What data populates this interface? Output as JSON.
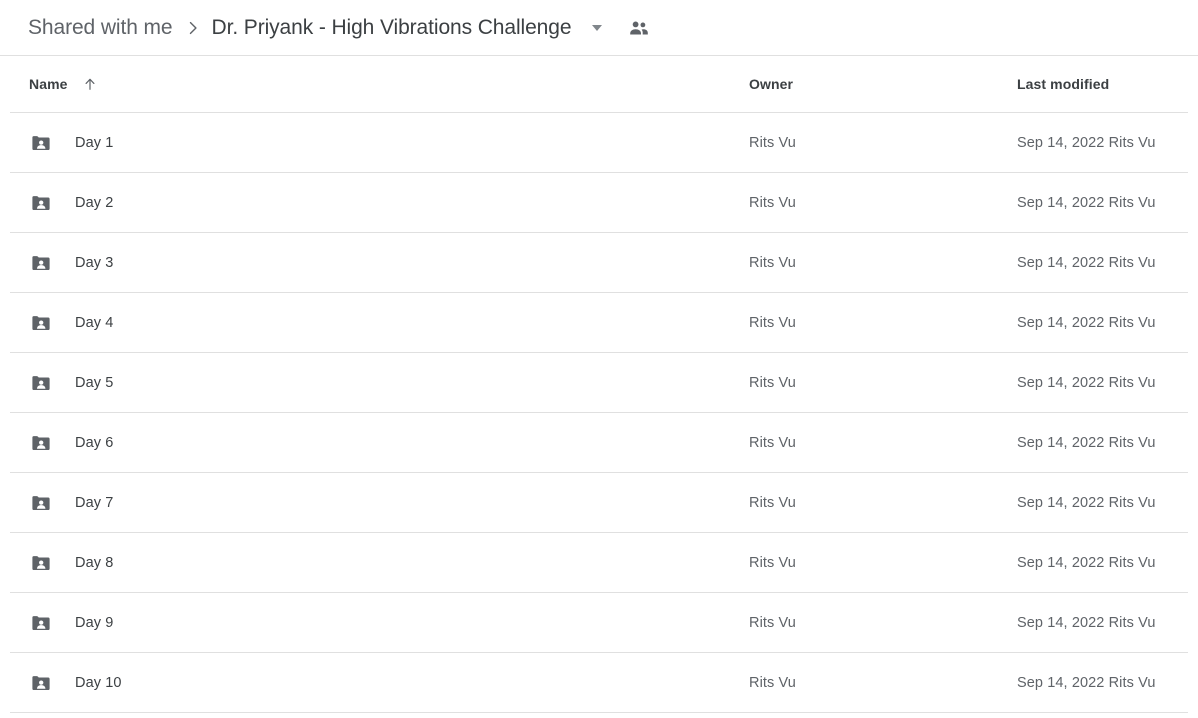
{
  "breadcrumb": {
    "parent_label": "Shared with me",
    "separator_icon": "chevron-right-icon",
    "current_label": "Dr. Priyank - High Vibrations Challenge",
    "caret_icon": "chevron-down-icon",
    "people_icon": "people-icon"
  },
  "columns": {
    "name_label": "Name",
    "sort_icon": "arrow-up-icon",
    "owner_label": "Owner",
    "modified_label": "Last modified"
  },
  "colors": {
    "text_primary": "#3c4043",
    "text_secondary": "#5f6368",
    "divider": "#e0e0e0",
    "folder_icon": "#5f6368",
    "background": "#ffffff"
  },
  "rows": [
    {
      "name": "Day 1",
      "icon": "shared-folder-icon",
      "owner": "Rits Vu",
      "modified": "Sep 14, 2022 Rits Vu"
    },
    {
      "name": "Day 2",
      "icon": "shared-folder-icon",
      "owner": "Rits Vu",
      "modified": "Sep 14, 2022 Rits Vu"
    },
    {
      "name": "Day 3",
      "icon": "shared-folder-icon",
      "owner": "Rits Vu",
      "modified": "Sep 14, 2022 Rits Vu"
    },
    {
      "name": "Day 4",
      "icon": "shared-folder-icon",
      "owner": "Rits Vu",
      "modified": "Sep 14, 2022 Rits Vu"
    },
    {
      "name": "Day 5",
      "icon": "shared-folder-icon",
      "owner": "Rits Vu",
      "modified": "Sep 14, 2022 Rits Vu"
    },
    {
      "name": "Day 6",
      "icon": "shared-folder-icon",
      "owner": "Rits Vu",
      "modified": "Sep 14, 2022 Rits Vu"
    },
    {
      "name": "Day 7",
      "icon": "shared-folder-icon",
      "owner": "Rits Vu",
      "modified": "Sep 14, 2022 Rits Vu"
    },
    {
      "name": "Day 8",
      "icon": "shared-folder-icon",
      "owner": "Rits Vu",
      "modified": "Sep 14, 2022 Rits Vu"
    },
    {
      "name": "Day 9",
      "icon": "shared-folder-icon",
      "owner": "Rits Vu",
      "modified": "Sep 14, 2022 Rits Vu"
    },
    {
      "name": "Day 10",
      "icon": "shared-folder-icon",
      "owner": "Rits Vu",
      "modified": "Sep 14, 2022 Rits Vu"
    }
  ]
}
